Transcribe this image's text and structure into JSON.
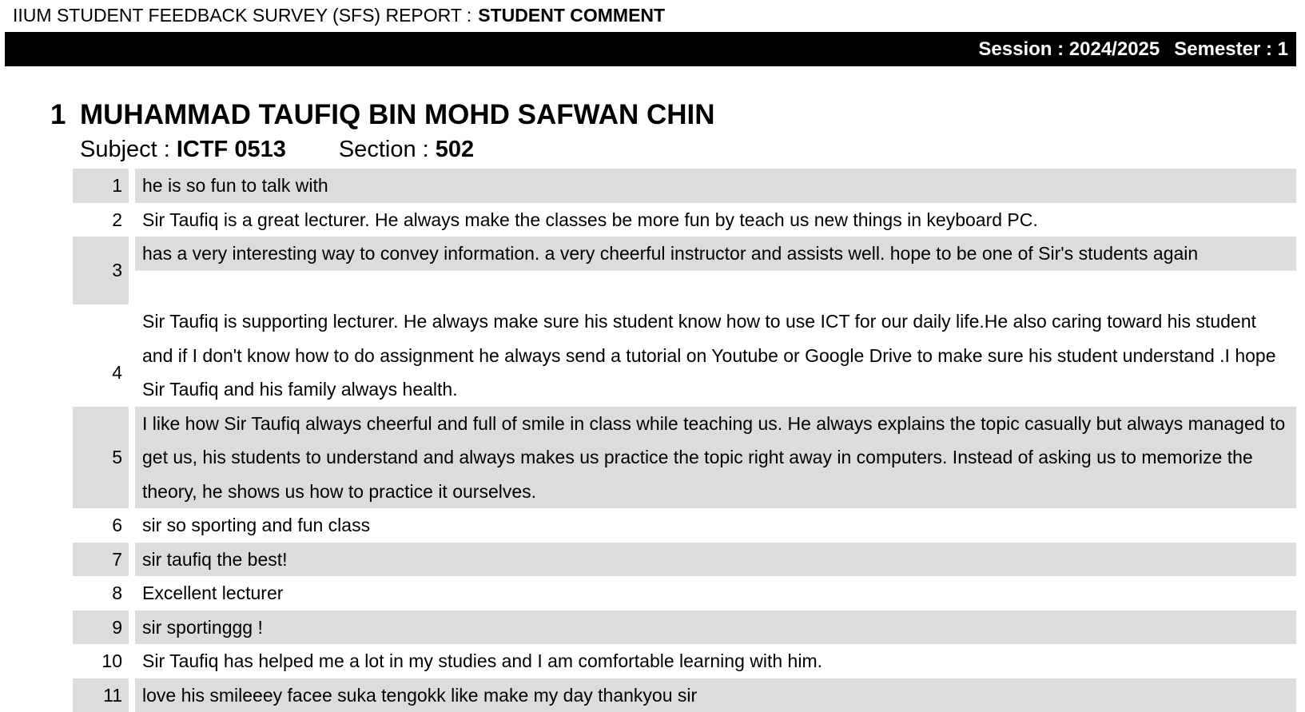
{
  "header": {
    "title_prefix": "IIUM STUDENT FEEDBACK SURVEY (SFS) REPORT :",
    "title_emphasis": "STUDENT COMMENT",
    "session_label": "Session : 2024/2025",
    "semester_label": "Semester : 1"
  },
  "lecturer": {
    "number": "1",
    "name": "MUHAMMAD TAUFIQ BIN MOHD SAFWAN CHIN",
    "subject_label": "Subject :",
    "subject_value": "ICTF 0513",
    "section_label": "Section :",
    "section_value": "502"
  },
  "comments": [
    {
      "no": "1",
      "text": "he is so fun to talk with"
    },
    {
      "no": "2",
      "text": "Sir Taufiq is a great lecturer. He always make the classes be more fun by teach us new things in keyboard PC."
    },
    {
      "no": "3",
      "text": "has a very interesting way to convey information. a very cheerful instructor and assists well. hope to be one of Sir's students again"
    },
    {
      "no": "4",
      "text": "Sir Taufiq is supporting lecturer. He always make sure his student know how to use ICT for our daily life.He also caring toward his student and if I don't know how to do assignment he always send a tutorial on Youtube or Google Drive to make sure his student understand .I hope Sir Taufiq and his family always health."
    },
    {
      "no": "5",
      "text": "I like how Sir Taufiq always cheerful and full of smile in class while teaching us. He always explains the topic casually but always managed to get us, his students to understand and always makes us practice the topic right away in computers. Instead of asking us to memorize the theory, he shows us how to practice it ourselves."
    },
    {
      "no": "6",
      "text": "sir so sporting and fun class"
    },
    {
      "no": "7",
      "text": "sir taufiq the best!"
    },
    {
      "no": "8",
      "text": "Excellent lecturer"
    },
    {
      "no": "9",
      "text": "sir sportinggg !"
    },
    {
      "no": "10",
      "text": "Sir Taufiq has helped me a lot in my studies and I am comfortable learning with him."
    },
    {
      "no": "11",
      "text": "love his smileeey facee suka tengokk like make my day thankyou sir"
    }
  ],
  "colors": {
    "bar_background": "#000000",
    "bar_text": "#ffffff",
    "row_shade": "#dcdcdc"
  }
}
